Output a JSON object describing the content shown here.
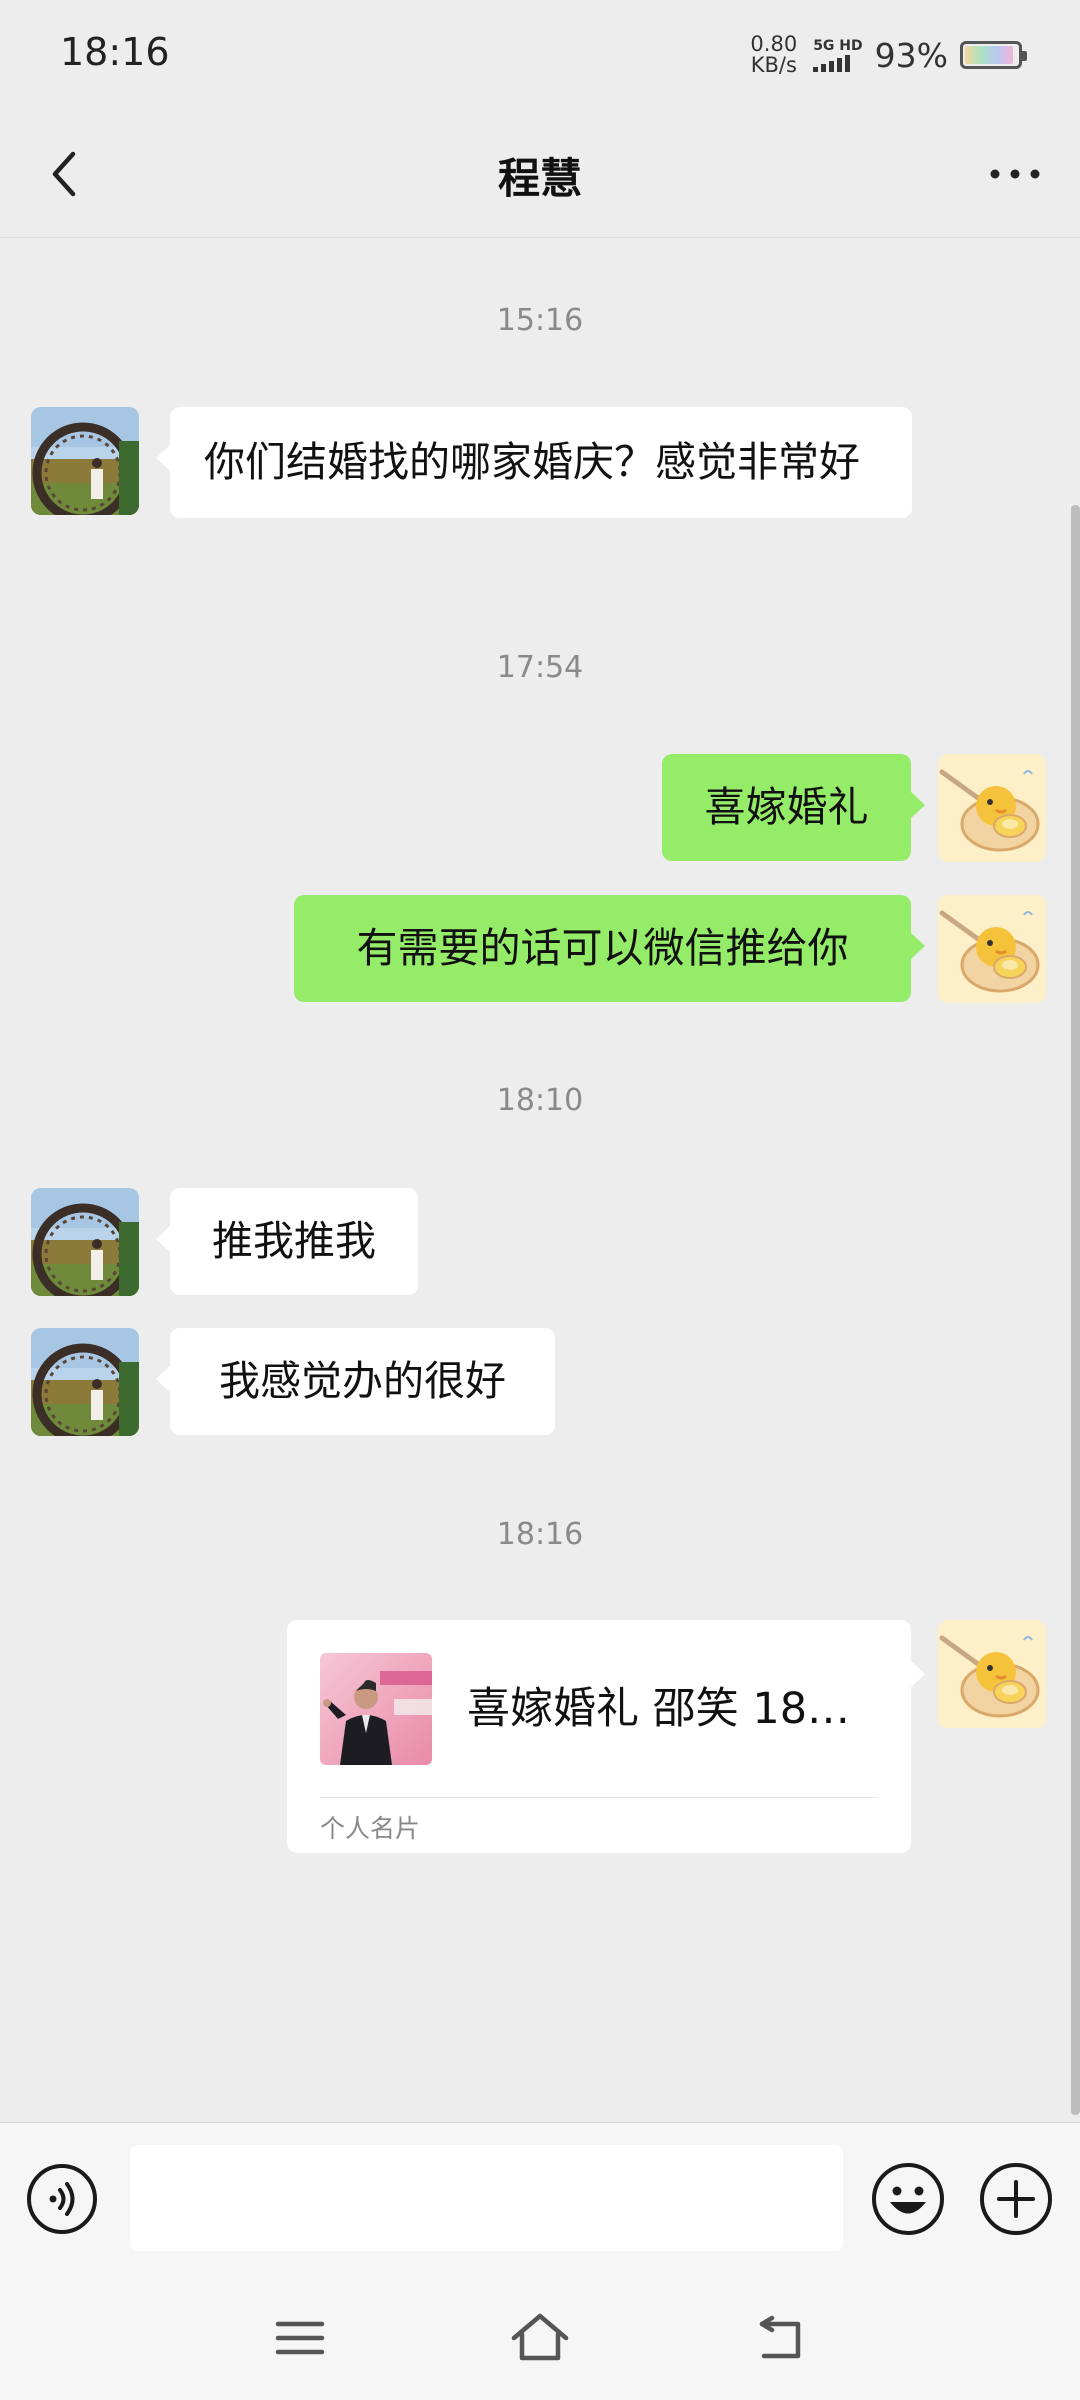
{
  "status_bar": {
    "time": "18:16",
    "net_speed_value": "0.80",
    "net_speed_unit": "KB/s",
    "network_label": "5G HD",
    "battery_percent": "93%",
    "battery_level": 0.93
  },
  "header": {
    "title": "程慧",
    "back_icon": "chevron-left-icon",
    "more_icon": "ellipsis-icon"
  },
  "messages": [
    {
      "type": "time",
      "text": "15:16"
    },
    {
      "type": "text",
      "from": "contact",
      "text": "你们结婚找的哪家婚庆？感觉非常好"
    },
    {
      "type": "time",
      "text": "17:54"
    },
    {
      "type": "text",
      "from": "me",
      "text": "喜嫁婚礼"
    },
    {
      "type": "text",
      "from": "me",
      "text": "有需要的话可以微信推给你"
    },
    {
      "type": "time",
      "text": "18:10"
    },
    {
      "type": "text",
      "from": "contact",
      "text": "推我推我"
    },
    {
      "type": "text",
      "from": "contact",
      "text": "我感觉办的很好"
    },
    {
      "type": "time",
      "text": "18:16"
    },
    {
      "type": "card",
      "from": "me",
      "name": "喜嫁婚礼 邵笑 18…",
      "label": "个人名片"
    }
  ],
  "input_bar": {
    "voice_icon": "voice-icon",
    "input_value": "",
    "emoji_icon": "emoji-icon",
    "plus_icon": "plus-icon"
  },
  "system_nav": {
    "menu_icon": "menu-icon",
    "home_icon": "home-icon",
    "back_icon": "back-icon"
  },
  "colors": {
    "background": "#ededed",
    "outgoing_bubble": "#95ec69",
    "incoming_bubble": "#ffffff",
    "timestamp": "#8a8a8a"
  }
}
